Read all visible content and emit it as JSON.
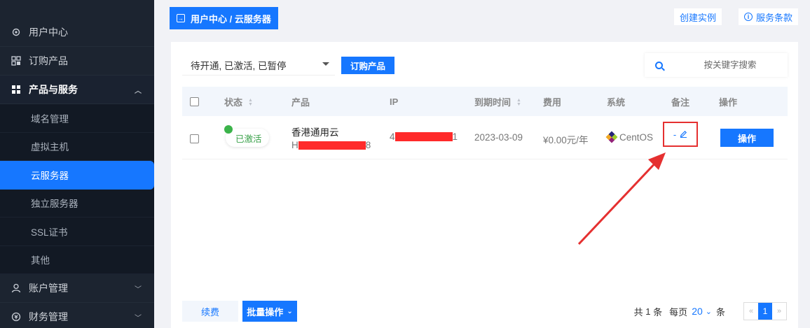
{
  "sidebar": {
    "items": [
      {
        "label": "用户中心",
        "icon": "gear-icon"
      },
      {
        "label": "订购产品",
        "icon": "grid-icon"
      },
      {
        "label": "产品与服务",
        "icon": "apps-icon"
      }
    ],
    "submenu": [
      "域名管理",
      "虚拟主机",
      "云服务器",
      "独立服务器",
      "SSL证书",
      "其他"
    ],
    "bottom": [
      {
        "label": "账户管理",
        "icon": "user-icon"
      },
      {
        "label": "财务管理",
        "icon": "finance-icon"
      }
    ]
  },
  "header": {
    "breadcrumb": "用户中心 / 云服务器",
    "create_instance": "创建实例",
    "terms": "服务条款"
  },
  "toolbar": {
    "filter_value": "待开通, 已激活, 已暂停",
    "order_button": "订购产品",
    "search_placeholder": "按关键字搜索"
  },
  "table": {
    "headers": {
      "status": "状态",
      "product": "产品",
      "ip": "IP",
      "expire": "到期时间",
      "fee": "费用",
      "system": "系统",
      "note": "备注",
      "action": "操作"
    },
    "rows": [
      {
        "status": "已激活",
        "product_name": "香港通用云",
        "product_sub_prefix": "H",
        "product_sub_suffix": "8",
        "ip_prefix": "4",
        "ip_suffix": "1",
        "expire": "2023-03-09",
        "fee": "¥0.00元/年",
        "system": "CentOS",
        "note": "-",
        "action": "操作"
      }
    ]
  },
  "footer": {
    "renew": "续费",
    "batch": "批量操作",
    "total_prefix": "共",
    "total_count": "1",
    "total_suffix": "条",
    "per_page_label": "每页",
    "per_page": "20",
    "per_page_suffix": "条",
    "prev": "«",
    "current_page": "1",
    "next": "»"
  },
  "colors": {
    "accent": "#1677ff",
    "sidebar_bg": "#1c2430",
    "active_status": "#3bb34a",
    "highlight": "#e53030"
  }
}
